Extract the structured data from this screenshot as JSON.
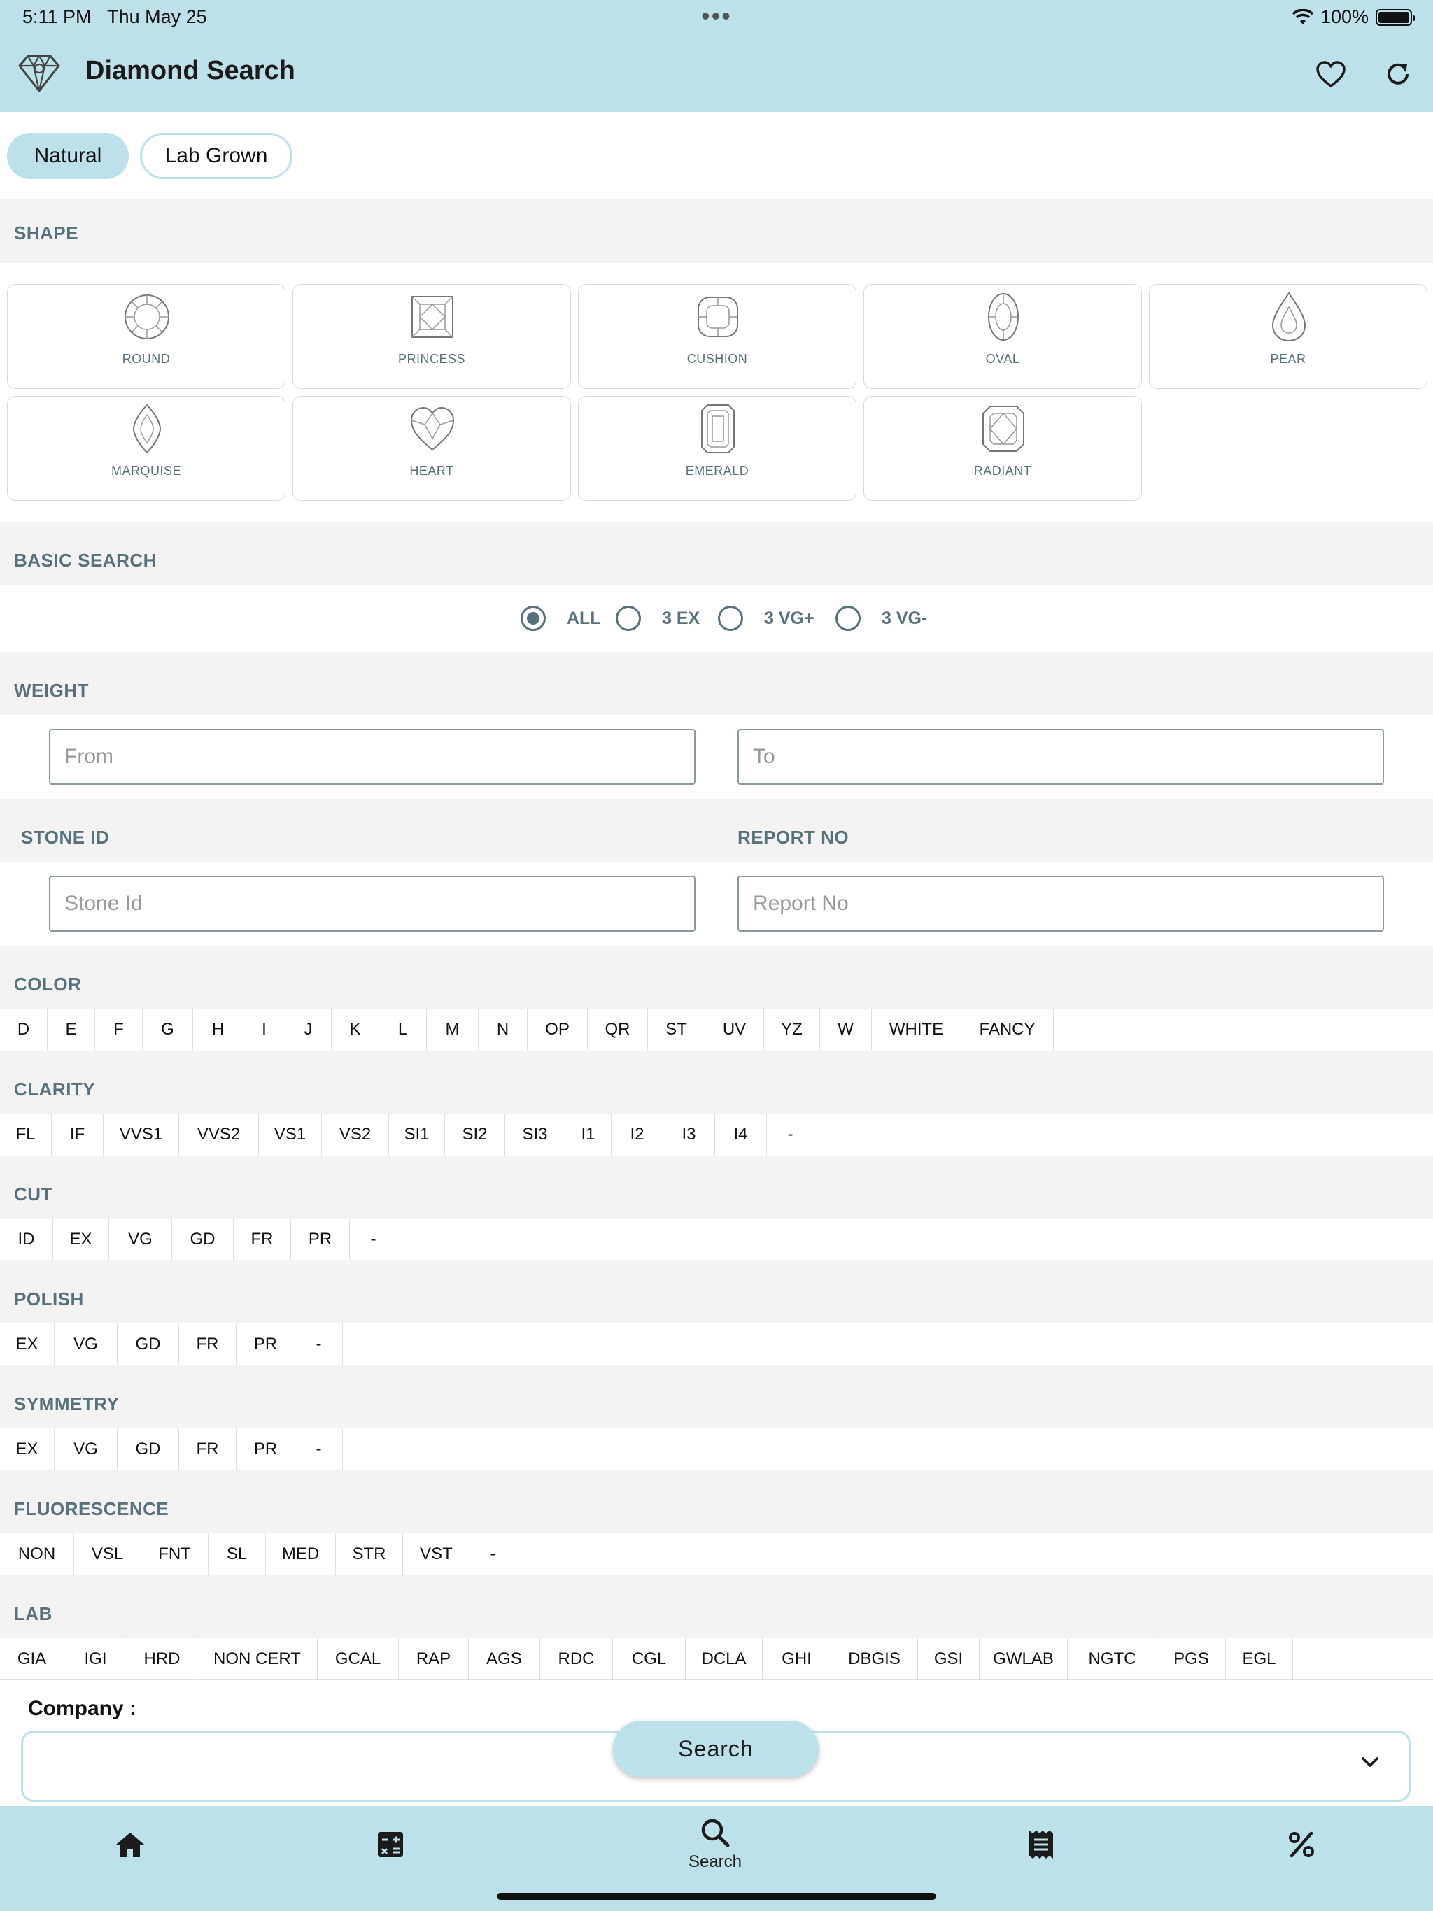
{
  "status_bar": {
    "time": "5:11 PM",
    "date": "Thu May 25",
    "dots": "•••",
    "battery": "100%"
  },
  "header": {
    "title": "Diamond Search"
  },
  "tabs": [
    {
      "label": "Natural"
    },
    {
      "label": "Lab Grown"
    }
  ],
  "shape": {
    "title": "SHAPE",
    "items": [
      "ROUND",
      "PRINCESS",
      "CUSHION",
      "OVAL",
      "PEAR",
      "MARQUISE",
      "HEART",
      "EMERALD",
      "RADIANT"
    ]
  },
  "basic_search": {
    "title": "BASIC SEARCH",
    "options": [
      "ALL",
      "3 EX",
      "3 VG+",
      "3 VG-"
    ],
    "selected": "ALL"
  },
  "weight": {
    "title": "WEIGHT",
    "from_placeholder": "From",
    "to_placeholder": "To"
  },
  "ids": {
    "stone_title": "STONE ID",
    "report_title": "REPORT NO",
    "stone_placeholder": "Stone Id",
    "report_placeholder": "Report No"
  },
  "color": {
    "title": "COLOR",
    "options": [
      "D",
      "E",
      "F",
      "G",
      "H",
      "I",
      "J",
      "K",
      "L",
      "M",
      "N",
      "OP",
      "QR",
      "ST",
      "UV",
      "YZ",
      "W",
      "WHITE",
      "FANCY"
    ]
  },
  "clarity": {
    "title": "CLARITY",
    "options": [
      "FL",
      "IF",
      "VVS1",
      "VVS2",
      "VS1",
      "VS2",
      "SI1",
      "SI2",
      "SI3",
      "I1",
      "I2",
      "I3",
      "I4",
      "-"
    ]
  },
  "cut": {
    "title": "CUT",
    "options": [
      "ID",
      "EX",
      "VG",
      "GD",
      "FR",
      "PR",
      "-"
    ]
  },
  "polish": {
    "title": "POLISH",
    "options": [
      "EX",
      "VG",
      "GD",
      "FR",
      "PR",
      "-"
    ]
  },
  "symmetry": {
    "title": "SYMMETRY",
    "options": [
      "EX",
      "VG",
      "GD",
      "FR",
      "PR",
      "-"
    ]
  },
  "fluorescence": {
    "title": "FLUORESCENCE",
    "options": [
      "NON",
      "VSL",
      "FNT",
      "SL",
      "MED",
      "STR",
      "VST",
      "-"
    ]
  },
  "lab": {
    "title": "LAB",
    "options": [
      "GIA",
      "IGI",
      "HRD",
      "NON CERT",
      "GCAL",
      "RAP",
      "AGS",
      "RDC",
      "CGL",
      "DCLA",
      "GHI",
      "DBGIS",
      "GSI",
      "GWLAB",
      "NGTC",
      "PGS",
      "EGL"
    ]
  },
  "company": {
    "label": "Company :"
  },
  "search_button": "Search",
  "bottom_nav": {
    "search_label": "Search"
  },
  "colors": {
    "accent": "#bee0e8",
    "label": "#59717b",
    "section_bg": "#f3f3f3"
  },
  "icons": [
    "diamond-logo-icon",
    "heart-icon",
    "refresh-icon",
    "home-icon",
    "calculator-icon",
    "search-icon",
    "receipt-icon",
    "percent-icon",
    "chevron-down-icon",
    "wifi-icon",
    "battery-icon"
  ]
}
